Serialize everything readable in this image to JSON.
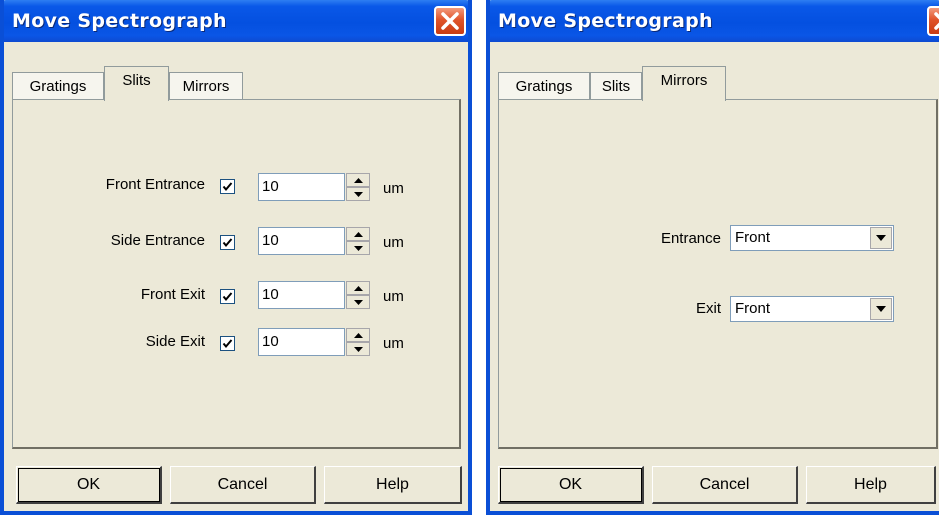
{
  "dialog_title": "Move Spectrograph",
  "tabs": [
    "Gratings",
    "Slits",
    "Mirrors"
  ],
  "slits": {
    "rows": [
      {
        "label": "Front Entrance",
        "checked": true,
        "value": "10",
        "unit": "um"
      },
      {
        "label": "Side Entrance",
        "checked": true,
        "value": "10",
        "unit": "um"
      },
      {
        "label": "Front Exit",
        "checked": true,
        "value": "10",
        "unit": "um"
      },
      {
        "label": "Side Exit",
        "checked": true,
        "value": "10",
        "unit": "um"
      }
    ]
  },
  "mirrors": {
    "entrance_label": "Entrance",
    "entrance_value": "Front",
    "exit_label": "Exit",
    "exit_value": "Front"
  },
  "buttons": {
    "ok": "OK",
    "cancel": "Cancel",
    "help": "Help"
  },
  "icons": {
    "close": "close-icon",
    "check": "checkmark-icon",
    "spin_up": "arrow-up-icon",
    "spin_down": "arrow-down-icon",
    "dropdown": "chevron-down-icon"
  },
  "colors": {
    "titlebar": "#0a58e8",
    "close_button": "#e0542a",
    "dialog_bg": "#ece9d8"
  }
}
